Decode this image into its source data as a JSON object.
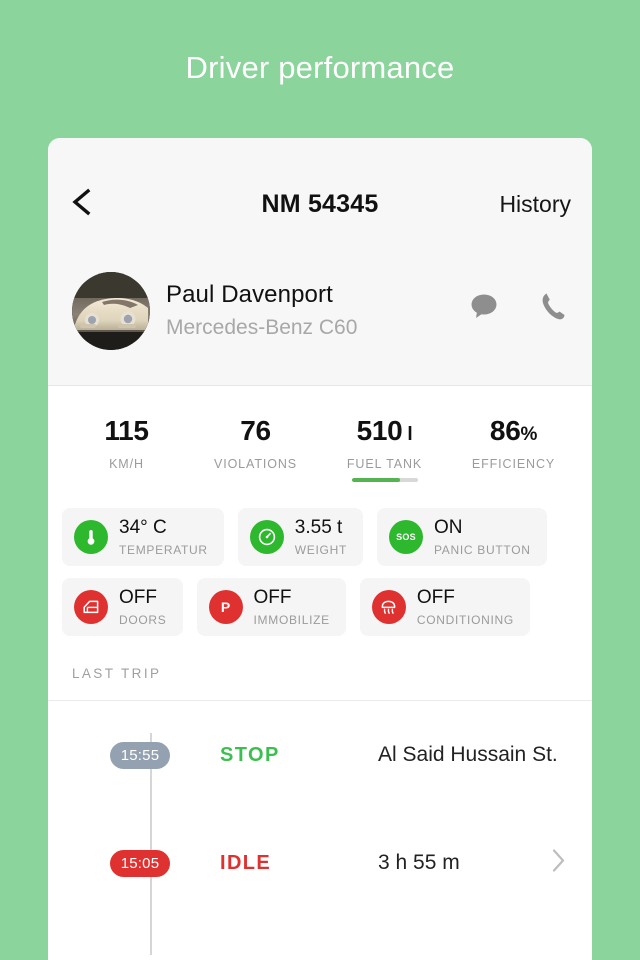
{
  "page": {
    "title": "Driver performance",
    "background_color": "#8BD49B"
  },
  "nav": {
    "back_icon": "chevron-left-icon",
    "title": "NM 54345",
    "action_label": "History"
  },
  "driver": {
    "avatar_icon": "driver-avatar-car-photo",
    "name": "Paul Davenport",
    "vehicle": "Mercedes-Benz C60",
    "message_icon": "chat-bubble-icon",
    "call_icon": "phone-icon"
  },
  "stats": [
    {
      "value": "115",
      "unit": "",
      "label": "KM/H",
      "has_bar": false,
      "bar_percent": 0
    },
    {
      "value": "76",
      "unit": "",
      "label": "VIOLATIONS",
      "has_bar": false,
      "bar_percent": 0
    },
    {
      "value": "510",
      "unit": " l",
      "label": "FUEL TANK",
      "has_bar": true,
      "bar_percent": 73
    },
    {
      "value": "86",
      "unit": "%",
      "label": "EFFICIENCY",
      "has_bar": false,
      "bar_percent": 0
    }
  ],
  "chips": {
    "row1": [
      {
        "icon": "thermometer-icon",
        "color": "#2EB82E",
        "state": "green",
        "value": "34° C",
        "label": "TEMPERATUR"
      },
      {
        "icon": "gauge-icon",
        "color": "#2EB82E",
        "state": "green",
        "value": "3.55 t",
        "label": "WEIGHT"
      },
      {
        "icon": "sos-icon",
        "color": "#2EB82E",
        "state": "green",
        "value": "ON",
        "label": "PANIC BUTTON"
      }
    ],
    "row2": [
      {
        "icon": "car-door-icon",
        "color": "#E03131",
        "state": "red",
        "value": "OFF",
        "label": "DOORS"
      },
      {
        "icon": "parking-p-icon",
        "color": "#E03131",
        "state": "red",
        "value": "OFF",
        "label": "IMMOBILIZE"
      },
      {
        "icon": "defrost-icon",
        "color": "#E03131",
        "state": "red",
        "value": "OFF",
        "label": "CONDITIONING"
      }
    ]
  },
  "last_trip": {
    "section_label": "LAST TRIP",
    "rows": [
      {
        "time": "15:55",
        "pill_color": "#93A1B0",
        "status": "STOP",
        "status_color": "#3DBF4F",
        "detail": "Al Said Hussain St.",
        "has_chevron": false
      },
      {
        "time": "15:05",
        "pill_color": "#E03131",
        "status": "IDLE",
        "status_color": "#E03131",
        "detail": "3 h 55 m",
        "has_chevron": true
      }
    ],
    "chevron_icon": "chevron-right-icon"
  }
}
